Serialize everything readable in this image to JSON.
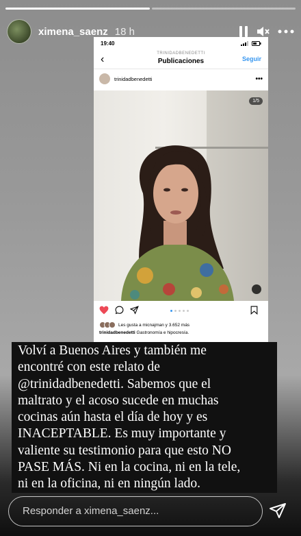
{
  "story": {
    "progress": [
      1,
      0
    ],
    "username": "ximena_saenz",
    "time_ago": "18 h"
  },
  "icons": {
    "pause": "pause-icon",
    "mute": "speaker-muted-icon",
    "more": "more-horizontal-icon",
    "send": "paper-plane-icon"
  },
  "embed": {
    "status_time": "19:40",
    "nav_subtitle": "TRINIDADBENEDETTI",
    "nav_title": "Publicaciones",
    "follow_label": "Seguir",
    "post_user": "trinidadbenedetti",
    "carousel_badge": "1/5",
    "likes_text": "Les gusta a micnajman y 3.652 más",
    "caption_user": "trinidadbenedetti",
    "caption_text": "Gastronomía e hipocresía."
  },
  "overlay_lines": [
    "Volví a Buenos Aires y también me",
    "encontré con este relato de",
    "@trinidadbenedetti. Sabemos que el",
    "maltrato y el acoso sucede en muchas",
    "cocinas aún hasta el día de hoy y es",
    "INACEPTABLE. Es muy importante y",
    "valiente su testimonio para que esto NO",
    "PASE MÁS. Ni en la cocina, ni en la tele,",
    "ni en la oficina, ni en ningún lado."
  ],
  "reply": {
    "placeholder": "Responder a ximena_saenz..."
  },
  "colors": {
    "link_blue": "#3897f0",
    "heart_red": "#ed4956"
  }
}
